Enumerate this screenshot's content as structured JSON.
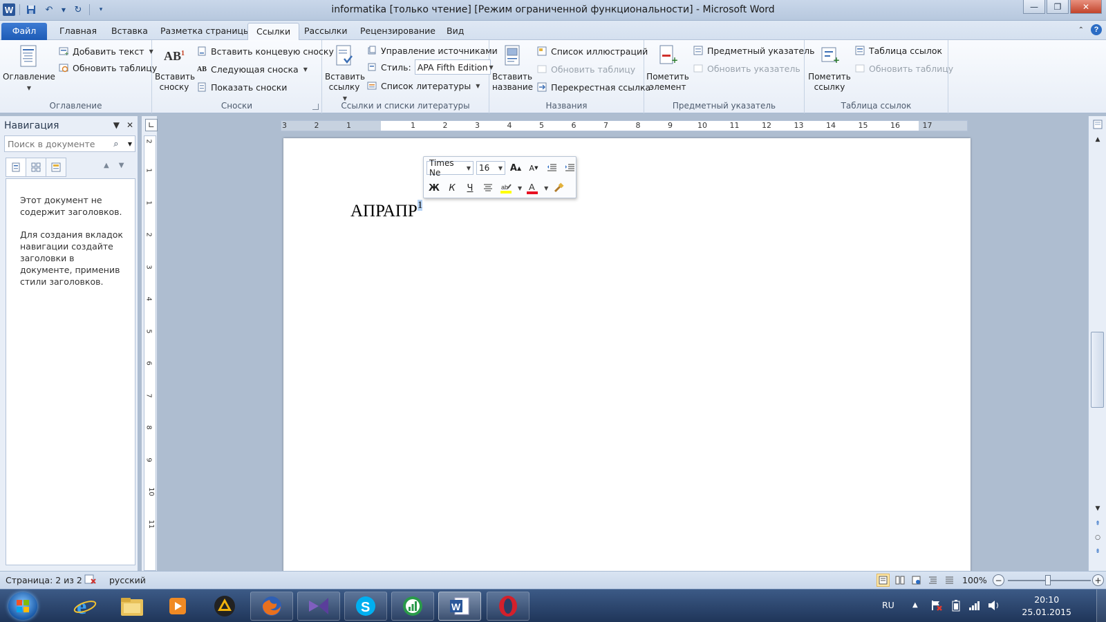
{
  "window": {
    "title": "informatika [только чтение] [Режим ограниченной функциональности]  -  Microsoft Word"
  },
  "tabs": [
    {
      "label": "Файл"
    },
    {
      "label": "Главная"
    },
    {
      "label": "Вставка"
    },
    {
      "label": "Разметка страницы"
    },
    {
      "label": "Ссылки"
    },
    {
      "label": "Рассылки"
    },
    {
      "label": "Рецензирование"
    },
    {
      "label": "Вид"
    }
  ],
  "ribbon": {
    "toc": {
      "label": "Оглавление",
      "big": "Оглавление",
      "add_text": "Добавить текст",
      "update_table": "Обновить таблицу"
    },
    "footnotes": {
      "label": "Сноски",
      "insert_footnote": "Вставить сноску",
      "insert_endnote": "Вставить концевую сноску",
      "next_footnote": "Следующая сноска",
      "show_notes": "Показать сноски"
    },
    "citations": {
      "label": "Ссылки и списки литературы",
      "insert_citation": "Вставить ссылку",
      "manage_sources": "Управление источниками",
      "style_label": "Стиль:",
      "style_value": "APA Fifth Edition",
      "bibliography": "Список литературы"
    },
    "captions": {
      "label": "Названия",
      "insert_caption": "Вставить название",
      "table_of_figures": "Список иллюстраций",
      "update_table": "Обновить таблицу",
      "cross_reference": "Перекрестная ссылка"
    },
    "index": {
      "label": "Предметный указатель",
      "mark_entry": "Пометить элемент",
      "insert_index": "Предметный указатель",
      "update_index": "Обновить указатель"
    },
    "authorities": {
      "label": "Таблица ссылок",
      "mark_citation": "Пометить ссылку",
      "insert_table": "Таблица ссылок",
      "update_table": "Обновить таблицу"
    }
  },
  "nav": {
    "title": "Навигация",
    "search_placeholder": "Поиск в документе",
    "message1": "Этот документ не содержит заголовков.",
    "message2": "Для создания вкладок навигации создайте заголовки в документе, применив стили заголовков."
  },
  "ruler": {
    "h": [
      "3",
      "2",
      "1",
      "1",
      "2",
      "3",
      "4",
      "5",
      "6",
      "7",
      "8",
      "9",
      "10",
      "11",
      "12",
      "13",
      "14",
      "15",
      "16",
      "17"
    ],
    "v": [
      "2",
      "1",
      "1",
      "2",
      "3",
      "4",
      "5",
      "6",
      "7",
      "8",
      "9",
      "10",
      "11"
    ]
  },
  "document": {
    "text": "АПРАПР",
    "footnote_ref": "1"
  },
  "minibar": {
    "font": "Times Ne",
    "size": "16",
    "bold": "Ж",
    "italic": "К",
    "underline": "Ч"
  },
  "status": {
    "page": "Страница: 2 из 2",
    "language": "русский",
    "zoom": "100%",
    "zoom_percent": 100
  },
  "taskbar": {
    "lang": "RU",
    "time": "20:10",
    "date": "25.01.2015"
  },
  "colors": {
    "accent": "#2b579a",
    "file_tab": "#1d5bb6",
    "highlight": "#ffff00",
    "font_color": "#e81123"
  }
}
